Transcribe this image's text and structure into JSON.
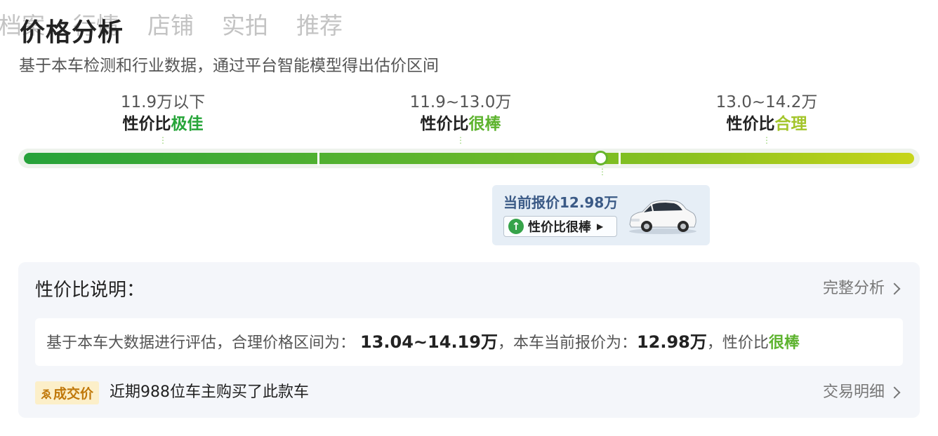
{
  "tabs": [
    "档案",
    "行情",
    "店铺",
    "实拍",
    "推荐"
  ],
  "title": "价格分析",
  "subtitle": "基于本车检测和行业数据，通过平台智能模型得出估价区间",
  "segments": [
    {
      "range": "11.9万以下",
      "prefix": "性价比",
      "rating": "极佳"
    },
    {
      "range": "11.9~13.0万",
      "prefix": "性价比",
      "rating": "很棒"
    },
    {
      "range": "13.0~14.2万",
      "prefix": "性价比",
      "rating": "合理"
    }
  ],
  "current": {
    "price_text": "当前报价12.98万",
    "badge_label": "性价比很棒",
    "badge_icon": "arrow-up-circle-icon",
    "car_icon": "suv-car-icon"
  },
  "explain": {
    "title": "性价比说明：",
    "full_analysis": "完整分析",
    "text_prefix": "基于本车大数据进行评估，合理价格区间为：",
    "fair_range": "13.04~14.19万",
    "text_mid": "，本车当前报价为：",
    "current_price": "12.98万",
    "text_suffix": "，性价比",
    "rating": "很棒",
    "deal_badge": "成交价",
    "deal_text": "近期988位车主购买了此款车",
    "deal_link": "交易明细"
  },
  "colors": {
    "best": "#27a53a",
    "great": "#5db32e",
    "ok": "#a3c52a",
    "price_blue": "#3b5a86"
  }
}
